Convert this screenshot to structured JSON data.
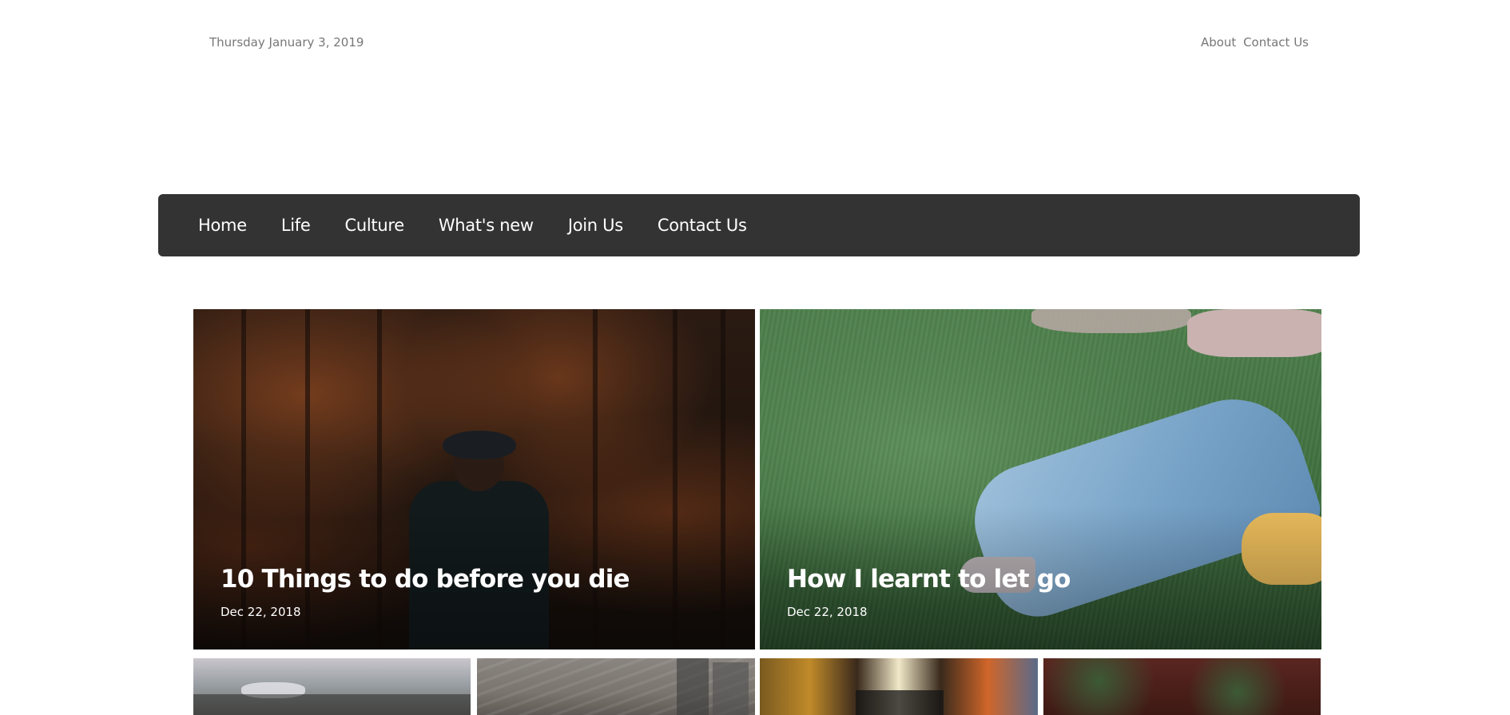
{
  "topbar": {
    "date": "Thursday January 3, 2019",
    "links": [
      "About",
      "Contact Us"
    ]
  },
  "nav": {
    "items": [
      "Home",
      "Life",
      "Culture",
      "What's new",
      "Join Us",
      "Contact Us"
    ]
  },
  "featured": [
    {
      "title": "10 Things to do before you die",
      "date": "Dec 22, 2018"
    },
    {
      "title": "How I learnt to let go",
      "date": "Dec 22, 2018"
    }
  ],
  "colors": {
    "navbar_bg": "#333333",
    "nav_text": "#ffffff",
    "topbar_text": "#777777"
  }
}
